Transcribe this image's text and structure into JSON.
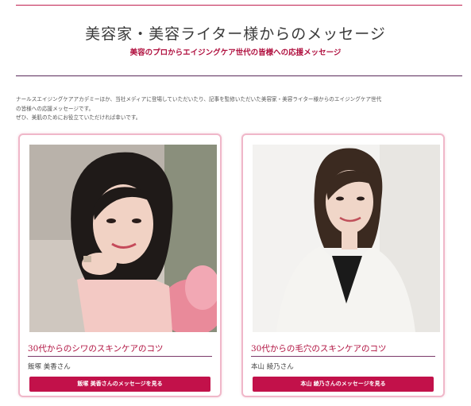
{
  "header": {
    "title": "美容家・美容ライター様からのメッセージ",
    "subtitle": "美容のプロからエイジングケア世代の皆様への応援メッセージ"
  },
  "intro": {
    "line1": "ナールスエイジングケアアカデミーほか、当社メディアに登場していただいたり、記事を監修いただいた美容家・美容ライター様からのエイジングケア世代",
    "line2": "の皆様への応援メッセージです。",
    "line3": "ぜひ、美肌のためにお役立ていただければ幸いです。"
  },
  "cards": [
    {
      "title": "30代からのシワのスキンケアのコツ",
      "name": "飯塚 美香さん",
      "button": "飯塚 美香さんのメッセージを見る"
    },
    {
      "title": "30代からの毛穴のスキンケアのコツ",
      "name": "本山 綾乃さん",
      "button": "本山 綾乃さんのメッセージを見る"
    }
  ],
  "colors": {
    "accent": "#c2114a",
    "card_border": "#f0b7c9",
    "rule": "#5a2a5a"
  }
}
